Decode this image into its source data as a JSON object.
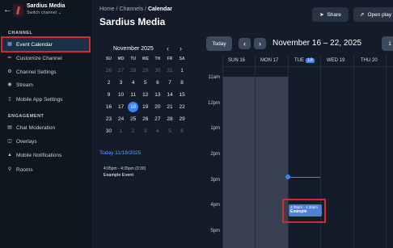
{
  "brand": {
    "name": "Sardius Media",
    "switch_label": "Switch channel"
  },
  "sidebar": {
    "section_channel": "CHANNEL",
    "section_engagement": "ENGAGEMENT",
    "items": [
      {
        "label": "Event Calendar",
        "icon": "calendar-icon"
      },
      {
        "label": "Customize Channel",
        "icon": "brush-icon"
      },
      {
        "label": "Channel Settings",
        "icon": "gear-icon"
      },
      {
        "label": "Stream",
        "icon": "broadcast-icon"
      },
      {
        "label": "Mobile App Settings",
        "icon": "phone-icon"
      },
      {
        "label": "Chat Moderation",
        "icon": "chat-icon"
      },
      {
        "label": "Overlays",
        "icon": "layers-icon"
      },
      {
        "label": "Mobile Notifications",
        "icon": "bell-icon"
      },
      {
        "label": "Rooms",
        "icon": "key-icon"
      }
    ]
  },
  "breadcrumb": {
    "home": "Home",
    "channels": "Channels",
    "current": "Calendar",
    "sep": "/"
  },
  "page_title": "Sardius Media",
  "header_buttons": {
    "share": "Share",
    "open_player": "Open play"
  },
  "mini_calendar": {
    "month": "November 2025",
    "weekdays": [
      "SU",
      "MO",
      "TU",
      "WE",
      "TH",
      "FR",
      "SA"
    ],
    "weeks": [
      [
        "26",
        "27",
        "28",
        "29",
        "30",
        "31",
        "1"
      ],
      [
        "2",
        "3",
        "4",
        "5",
        "6",
        "7",
        "8"
      ],
      [
        "9",
        "10",
        "11",
        "12",
        "13",
        "14",
        "15"
      ],
      [
        "16",
        "17",
        "18",
        "19",
        "20",
        "21",
        "22"
      ],
      [
        "23",
        "24",
        "25",
        "26",
        "27",
        "28",
        "29"
      ],
      [
        "30",
        "1",
        "2",
        "3",
        "4",
        "5",
        "6"
      ]
    ],
    "selected": "18"
  },
  "agenda": {
    "label": "Today 11/18/2025",
    "event_time": "4:05pm - 4:35pm (0:30)",
    "event_title": "Example Event"
  },
  "week_view": {
    "today_button": "Today",
    "range": "November 16 – 22, 2025",
    "days": [
      "SUN 16",
      "MON 17",
      "TUE",
      "WED 19",
      "THU 20"
    ],
    "today_badge": "18",
    "hours": [
      "11am",
      "12pm",
      "1pm",
      "2pm",
      "3pm",
      "4pm",
      "5pm"
    ],
    "event": {
      "time": "4:05pm - 4:35pm",
      "title": "Example"
    }
  },
  "colors": {
    "accent": "#3b82f6",
    "highlight": "#d6282f",
    "event": "#4f7fd6"
  }
}
